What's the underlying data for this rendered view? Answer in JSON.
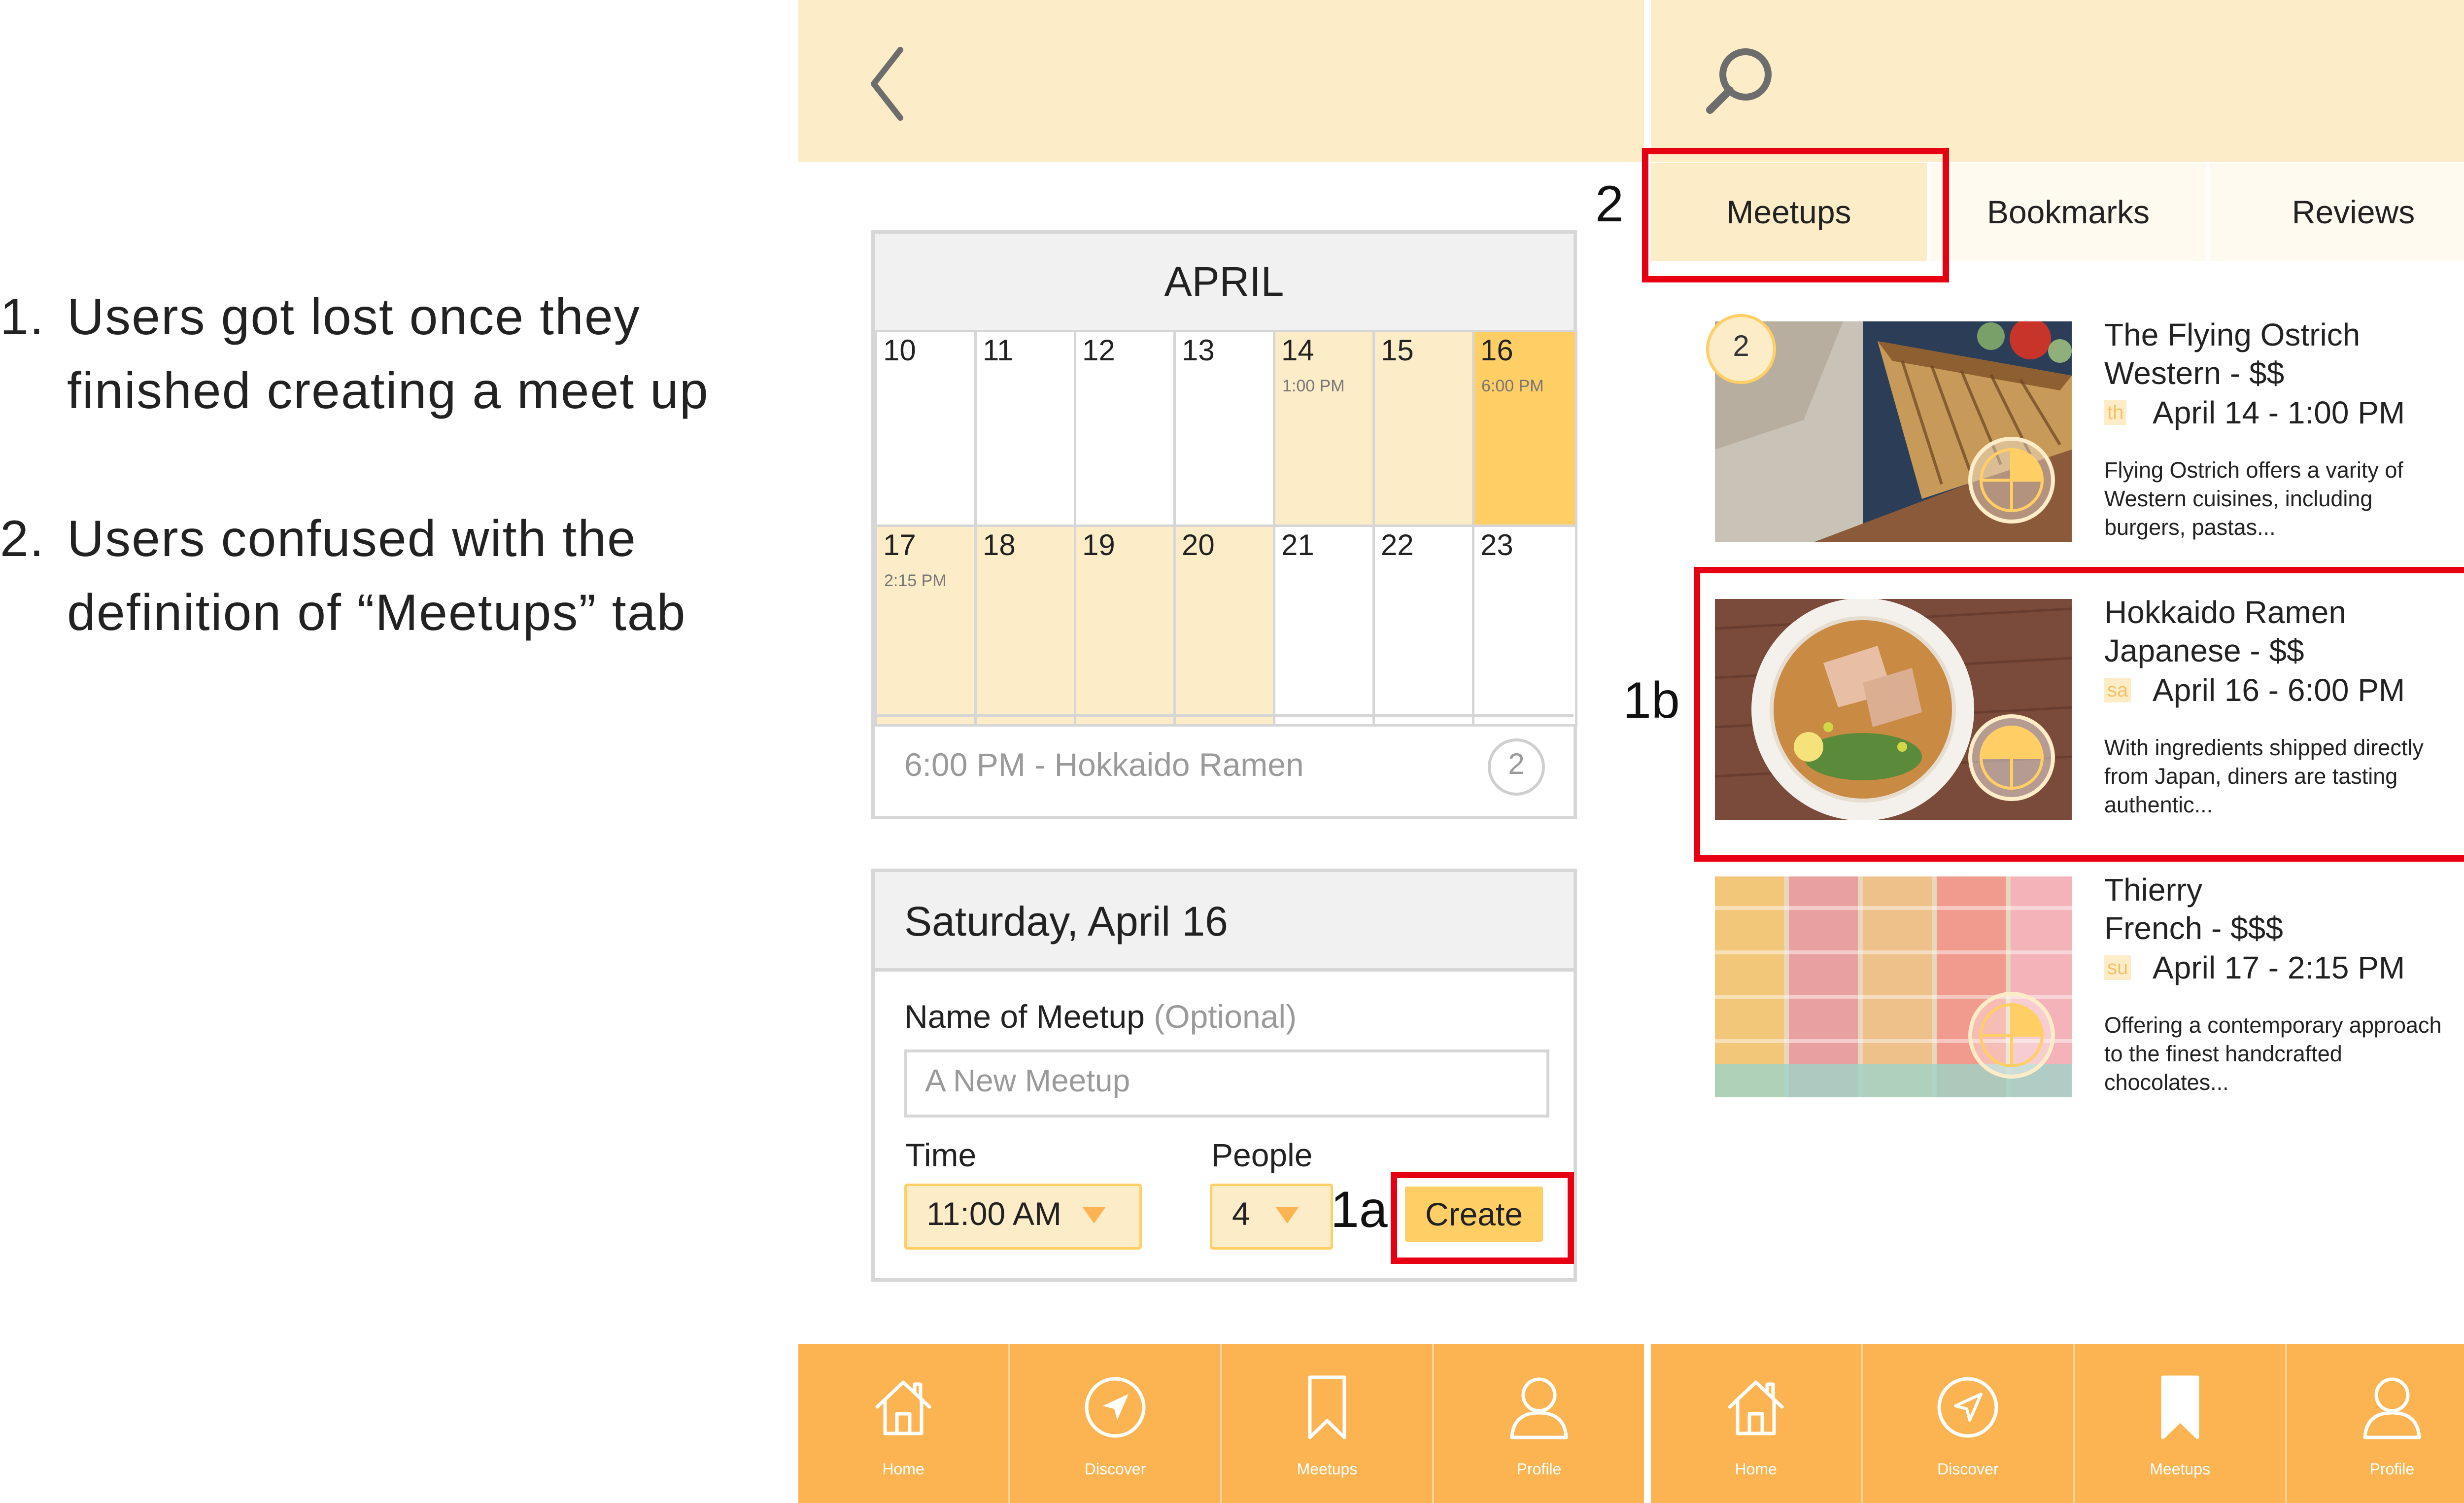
{
  "notes": [
    {
      "number": "1.",
      "text": "Users got lost once they finished creating a meet up"
    },
    {
      "number": "2.",
      "text": "Users confused with the definition of “Meetups” tab"
    }
  ],
  "left_screen": {
    "back_icon": "chevron-left-icon",
    "calendar": {
      "month": "APRIL",
      "days": [
        {
          "num": "10",
          "time": "",
          "state": "none"
        },
        {
          "num": "11",
          "time": "",
          "state": "none"
        },
        {
          "num": "12",
          "time": "",
          "state": "none"
        },
        {
          "num": "13",
          "time": "",
          "state": "none"
        },
        {
          "num": "14",
          "time": "1:00 PM",
          "state": "light"
        },
        {
          "num": "15",
          "time": "",
          "state": "light"
        },
        {
          "num": "16",
          "time": "6:00 PM",
          "state": "strong"
        },
        {
          "num": "17",
          "time": "2:15 PM",
          "state": "light"
        },
        {
          "num": "18",
          "time": "",
          "state": "light"
        },
        {
          "num": "19",
          "time": "",
          "state": "light"
        },
        {
          "num": "20",
          "time": "",
          "state": "light"
        },
        {
          "num": "21",
          "time": "",
          "state": "none"
        },
        {
          "num": "22",
          "time": "",
          "state": "none"
        },
        {
          "num": "23",
          "time": "",
          "state": "none"
        }
      ],
      "selected_event": "6:00 PM - Hokkaido Ramen",
      "selected_count": "2"
    },
    "form": {
      "date_title": "Saturday, April 16",
      "name_label": "Name of Meetup",
      "name_optional": "(Optional)",
      "name_placeholder": "A New Meetup",
      "time_label": "Time",
      "time_value": "11:00 AM",
      "people_label": "People",
      "people_value": "4",
      "create_label": "Create"
    },
    "nav": [
      {
        "label": "Home",
        "icon": "home-icon"
      },
      {
        "label": "Discover",
        "icon": "compass-icon"
      },
      {
        "label": "Meetups",
        "icon": "bookmark-icon"
      },
      {
        "label": "Profile",
        "icon": "profile-icon"
      }
    ]
  },
  "right_screen": {
    "search_icon": "search-icon",
    "tabs": [
      "Meetups",
      "Bookmarks",
      "Reviews"
    ],
    "active_tab": "Meetups",
    "results": [
      {
        "name": "The Flying Ostrich",
        "cuisine": "Western - $$",
        "day_badge": "th",
        "date": "April 14 - 1:00 PM",
        "desc": "Flying Ostrich offers a varity of Western cuisines, including burgers, pastas...",
        "count": "2",
        "fill": 0.25
      },
      {
        "name": "Hokkaido Ramen",
        "cuisine": "Japanese - $$",
        "day_badge": "sa",
        "date": "April 16 - 6:00 PM",
        "desc": "With ingredients shipped directly from Japan, diners are tasting authentic...",
        "count": "",
        "fill": 0.5
      },
      {
        "name": "Thierry",
        "cuisine": "French - $$$",
        "day_badge": "su",
        "date": "April 17 - 2:15 PM",
        "desc": "Offering a contemporary approach to the finest handcrafted chocolates...",
        "count": "",
        "fill": 0.25
      }
    ],
    "nav": [
      {
        "label": "Home",
        "icon": "home-icon"
      },
      {
        "label": "Discover",
        "icon": "compass-icon"
      },
      {
        "label": "Meetups",
        "icon": "bookmark-filled-icon"
      },
      {
        "label": "Profile",
        "icon": "profile-icon"
      }
    ]
  },
  "callouts": {
    "create": "1a",
    "result": "1b",
    "tab": "2"
  },
  "colors": {
    "accent": "#fbb451",
    "light": "#fdecc8",
    "highlight": "#ffcf66",
    "annotation": "#e60012"
  }
}
